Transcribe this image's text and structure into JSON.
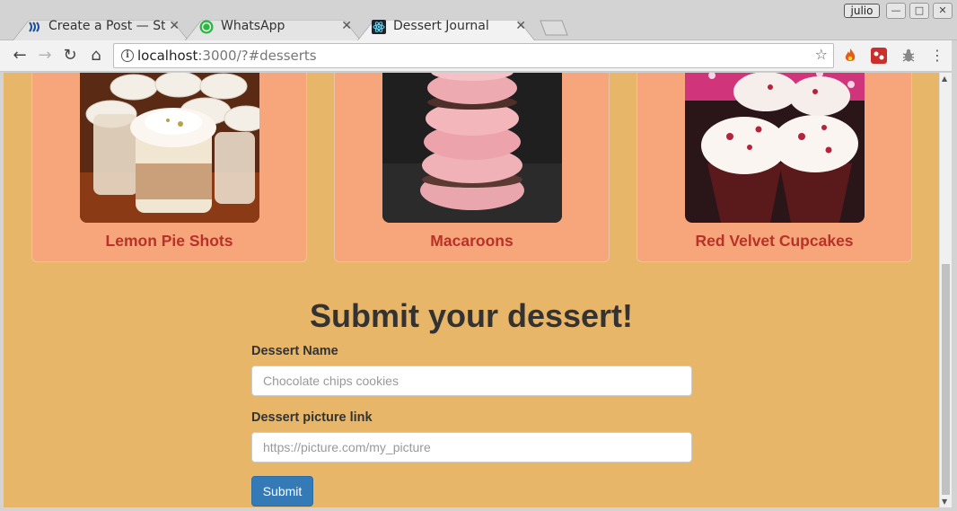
{
  "browser": {
    "tabs": [
      {
        "title": "Create a Post — Ste",
        "active": false
      },
      {
        "title": "WhatsApp",
        "active": false
      },
      {
        "title": "Dessert Journal",
        "active": true
      }
    ],
    "profile_name": "julio",
    "close_glyph": "✕",
    "address": {
      "host": "localhost",
      "rest": ":3000/?#desserts"
    }
  },
  "colors": {
    "page_background": "#e8b668",
    "card_background": "#f7a57a",
    "card_title": "#b8322a",
    "submit_button": "#337ab7"
  },
  "desserts": [
    {
      "name": "Lemon Pie Shots"
    },
    {
      "name": "Macaroons"
    },
    {
      "name": "Red Velvet Cupcakes"
    }
  ],
  "form": {
    "heading": "Submit your dessert!",
    "name_label": "Dessert Name",
    "name_placeholder": "Chocolate chips cookies",
    "link_label": "Dessert picture link",
    "link_placeholder": "https://picture.com/my_picture",
    "submit_label": "Submit"
  }
}
